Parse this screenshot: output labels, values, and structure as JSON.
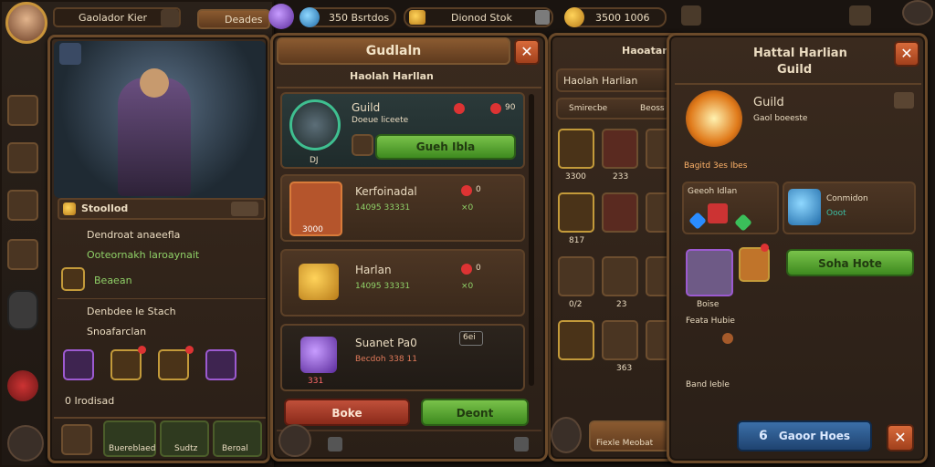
{
  "left": {
    "player_name": "Gaolador Kier",
    "resource_label": "Deades",
    "section_title": "Stoollod",
    "rows": [
      "Dendroat anaeefla",
      "Ooteornakh laroaynait",
      "Beaean",
      "Denbdee le Stach",
      "Snoafarclan"
    ],
    "footer_count": "0 Irodisad",
    "nav": [
      "Buereblaed",
      "Sudtz",
      "Beroal"
    ]
  },
  "topbar": {
    "currency1": "350 Bsrtdos",
    "currency2": "Dionod Stok",
    "currency3": "3500 1006"
  },
  "main": {
    "title": "Gudlaln",
    "subtitle": "Haolah Harllan",
    "guild_name": "Guild",
    "guild_sub": "Doeue liceete",
    "guild_badge": "DJ",
    "guild_cost": "90",
    "guild_button": "Gueh Ibla",
    "items": [
      {
        "name": "Kerfoinadal",
        "sub": "14095 33331",
        "count": "0",
        "qty": "×0",
        "tag": "3000"
      },
      {
        "name": "Harlan",
        "sub": "14095 33331",
        "count": "0",
        "qty": "×0"
      },
      {
        "name": "Suanet Pa0",
        "sub": "Becdoh 338 11",
        "tag": "331",
        "badge": "6ei"
      }
    ],
    "btn_left": "Boke",
    "btn_right": "Deont"
  },
  "mid": {
    "title": "Haoatanian",
    "subtitle": "Haolah Harlian",
    "filter": "Smirecbe",
    "filter2": "Beoss",
    "grid_labels": [
      "3300",
      "233",
      "",
      "817",
      "",
      "",
      "0/2",
      "23",
      "",
      "",
      "363",
      ""
    ],
    "bottom": "Fiexle Meobat"
  },
  "right": {
    "title": "Hattal Harlian",
    "title2": "Guild",
    "guild_name": "Guild",
    "guild_sub": "Gaol boeeste",
    "badge_text": "Bagitd 3es Ibes",
    "sub1": "Geeoh Idlan",
    "sub2": "Conmidon",
    "sub2b": "Ooot",
    "action": "Soha Hote",
    "item_label": "Boise",
    "item_label2": "Feata Hubie",
    "bottom_label": "Band Ieble",
    "blue_button": "Gaoor Hoes",
    "blue_count": "6"
  }
}
